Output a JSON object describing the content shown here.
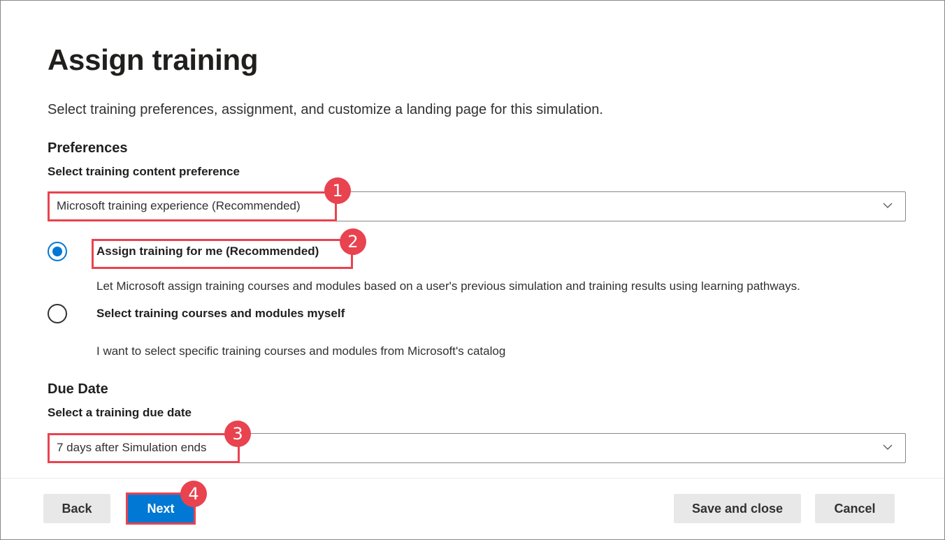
{
  "page": {
    "title": "Assign training",
    "description": "Select training preferences, assignment, and customize a landing page for this simulation."
  },
  "preferences": {
    "heading": "Preferences",
    "content_label": "Select training content preference",
    "content_value": "Microsoft training experience (Recommended)",
    "options": [
      {
        "title": "Assign training for me (Recommended)",
        "description": "Let Microsoft assign training courses and modules based on a user's previous simulation and training results using learning pathways.",
        "selected": true
      },
      {
        "title": "Select training courses and modules myself",
        "description": "I want to select specific training courses and modules from Microsoft's catalog",
        "selected": false
      }
    ]
  },
  "due_date": {
    "heading": "Due Date",
    "label": "Select a training due date",
    "value": "7 days after Simulation ends"
  },
  "footer": {
    "back_label": "Back",
    "next_label": "Next",
    "save_close_label": "Save and close",
    "cancel_label": "Cancel"
  },
  "annotations": {
    "badges": [
      "1",
      "2",
      "3",
      "4"
    ],
    "color": "#e8434f"
  },
  "colors": {
    "accent": "#0078d4",
    "text": "#323130",
    "button_gray": "#e8e8e8"
  },
  "icons": {
    "dropdown": "chevron-down-icon",
    "radio_selected": "radio-selected-icon",
    "radio_unselected": "radio-unselected-icon"
  }
}
